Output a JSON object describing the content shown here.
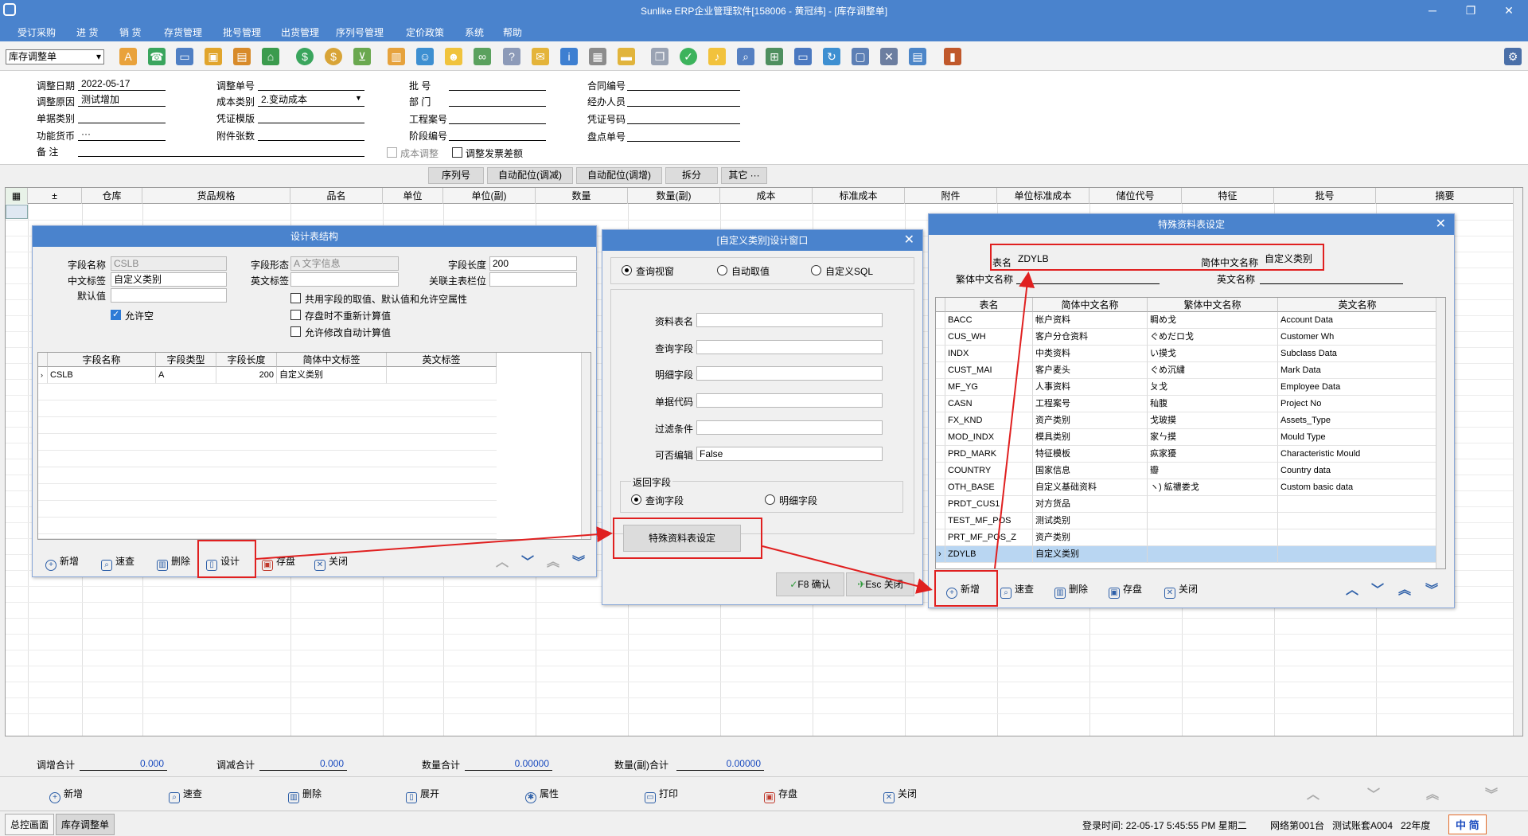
{
  "window": {
    "title": "Sunlike ERP企业管理软件[158006 - 黄冠纬] - [库存调整单]",
    "minimize": "─",
    "restore": "❐",
    "close": "✕"
  },
  "menu": [
    "受订采购",
    "进 货",
    "销 货",
    "存货管理",
    "批号管理",
    "出货管理",
    "序列号管理",
    "定价政策",
    "系统",
    "帮助"
  ],
  "toolbar": {
    "form_select": "库存调整单"
  },
  "header": {
    "adjust_date_label": "调整日期",
    "adjust_date": "2022-05-17",
    "adjust_reason_label": "调整原因",
    "adjust_reason": "测试增加",
    "doc_type_label": "单据类别",
    "doc_type": "",
    "currency_label": "功能货币",
    "currency": "···",
    "remark_label": "备 注",
    "remark": "",
    "adjust_no_label": "调整单号",
    "adjust_no": "",
    "cost_type_label": "成本类别",
    "cost_type": "2.变动成本",
    "voucher_template_label": "凭证模版",
    "voucher_template": "",
    "attachments_label": "附件张数",
    "attachments": "",
    "batch_label": "批 号",
    "batch": "",
    "dept_label": "部 门",
    "dept": "",
    "project_label": "工程案号",
    "project": "",
    "phase_label": "阶段编号",
    "phase": "",
    "contract_label": "合同编号",
    "contract": "",
    "handler_label": "经办人员",
    "handler": "",
    "voucher_no_label": "凭证号码",
    "voucher_no": "",
    "stocktake_label": "盘点单号",
    "stocktake": "",
    "cost_adjust_label": "成本调整",
    "adjust_invoice_diff_label": "调整发票差额"
  },
  "action_buttons": [
    "序列号",
    "自动配位(调减)",
    "自动配位(调增)",
    "拆分",
    "其它 ···"
  ],
  "grid": {
    "columns": [
      "±",
      "仓库",
      "货品规格",
      "品名",
      "单位",
      "单位(副)",
      "数量",
      "数量(副)",
      "成本",
      "标准成本",
      "附件",
      "单位标准成本",
      "储位代号",
      "特征",
      "批号",
      "摘要"
    ]
  },
  "totals": {
    "adjust_total_label": "调增合计",
    "adjust_total": "0.000",
    "reduce_total_label": "调减合计",
    "reduce_total": "0.000",
    "qty_total_label": "数量合计",
    "qty_total": "0.00000",
    "qty2_total_label": "数量(副)合计",
    "qty2_total": "0.00000"
  },
  "bottom": {
    "new": "新增",
    "quick": "速查",
    "delete": "删除",
    "expand": "展开",
    "props": "属性",
    "print": "打印",
    "save": "存盘",
    "close": "关闭"
  },
  "status": {
    "tab1": "总控画面",
    "tab2": "库存调整单",
    "login": "登录时间: 22-05-17 5:45:55 PM 星期二",
    "net": "网络第001台",
    "account": "测试账套A004",
    "year": "22年度",
    "ime": "中 简"
  },
  "dlg1": {
    "title": "设计表结构",
    "field_name_label": "字段名称",
    "field_name": "CSLB",
    "cn_label_label": "中文标签",
    "cn_label": "自定义类别",
    "default_label": "默认值",
    "default": "",
    "allow_null": "允许空",
    "field_form_label": "字段形态",
    "field_form": "A 文字信息",
    "en_label_label": "英文标签",
    "en_label": "",
    "field_len_label": "字段长度",
    "field_len": "200",
    "link_label": "关联主表栏位",
    "link": "",
    "opt1": "共用字段的取值、默认值和允许空属性",
    "opt2": "存盘时不重新计算值",
    "opt3": "允许修改自动计算值",
    "cols": [
      "字段名称",
      "字段类型",
      "字段长度",
      "简体中文标签",
      "英文标签"
    ],
    "row": [
      "CSLB",
      "A",
      "200",
      "自定义类别",
      ""
    ],
    "btn_new": "新增",
    "btn_quick": "速查",
    "btn_delete": "删除",
    "btn_design": "设计",
    "btn_save": "存盘",
    "btn_close": "关闭"
  },
  "dlg2": {
    "title": "[自定义类别]设计窗口",
    "r1": "查询视窗",
    "r2": "自动取值",
    "r3": "自定义SQL",
    "table_label": "资料表名",
    "query_label": "查询字段",
    "detail_label": "明细字段",
    "doc_code_label": "单据代码",
    "filter_label": "过滤条件",
    "editable_label": "可否编辑",
    "editable": "False",
    "return_group": "返回字段",
    "ret1": "查询字段",
    "ret2": "明细字段",
    "special_btn": "特殊资料表设定",
    "ok": "F8 确认",
    "cancel": "Esc 关闭"
  },
  "dlg3": {
    "title": "特殊资料表设定",
    "table_label": "表名",
    "table": "ZDYLB",
    "sc_label": "简体中文名称",
    "sc": "自定义类别",
    "tc_label": "繁体中文名称",
    "tc": "",
    "en_label": "英文名称",
    "en": "",
    "cols": [
      "表名",
      "简体中文名称",
      "繁体中文名称",
      "英文名称"
    ],
    "rows": [
      [
        "BACC",
        "帐户资料",
        "睭め戈",
        "Account Data"
      ],
      [
        "CUS_WH",
        "客户分仓资料",
        "ぐめだロ戈",
        "Customer Wh"
      ],
      [
        "INDX",
        "中类资料",
        "い摸戈",
        "Subclass Data"
      ],
      [
        "CUST_MAI",
        "客户麦头",
        "ぐめ沉繍",
        "Mark Data"
      ],
      [
        "MF_YG",
        "人事资料",
        "ㄆ戈",
        "Employee Data"
      ],
      [
        "CASN",
        "工程案号",
        "秈腹",
        "Project No"
      ],
      [
        "FX_KND",
        "资产类别",
        "戈玻摸",
        "Assets_Type"
      ],
      [
        "MOD_INDX",
        "模具类别",
        "家ㄣ摸",
        "Mould Type"
      ],
      [
        "PRD_MARK",
        "特征模板",
        "疭家獶",
        "Characteristic Mould"
      ],
      [
        "COUNTRY",
        "国家信息",
        "瓣",
        "Country data"
      ],
      [
        "OTH_BASE",
        "自定义基础资料",
        "ヽ) 絋禯娄戈",
        "Custom basic data"
      ],
      [
        "PRDT_CUS1",
        "对方货品",
        "",
        ""
      ],
      [
        "TEST_MF_POS",
        "测试类别",
        "",
        ""
      ],
      [
        "PRT_MF_POS_Z",
        "资产类别",
        "",
        ""
      ],
      [
        "ZDYLB",
        "自定义类别",
        "",
        ""
      ]
    ],
    "btn_new": "新增",
    "btn_quick": "速查",
    "btn_delete": "删除",
    "btn_save": "存盘",
    "btn_close": "关闭"
  },
  "colors": {
    "title_blue": "#4a83cd",
    "highlight": "#b9d6f2",
    "annotation_red": "#e02020"
  }
}
